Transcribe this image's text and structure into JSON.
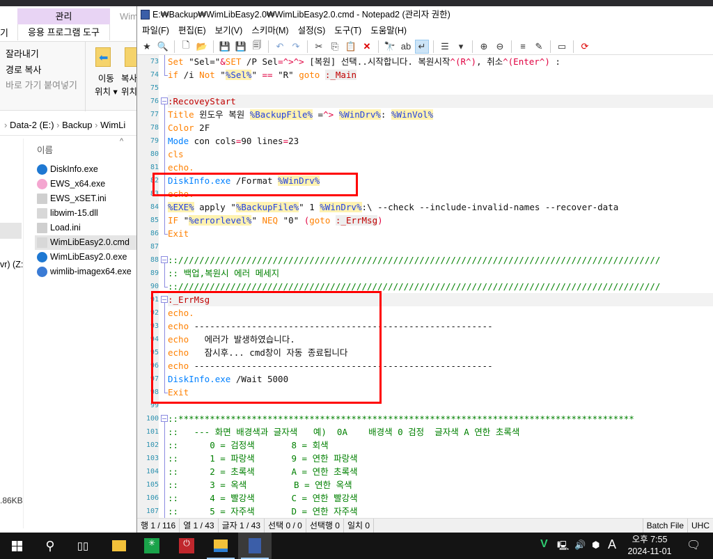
{
  "explorer": {
    "tabs": {
      "manage": "관리",
      "app_tools": "응용 프로그램 도구",
      "window_title_partial": "Wim",
      "left_cut": "기"
    },
    "ribbon": {
      "cut": "잘라내기",
      "copy_path": "경로 복사",
      "paste_shortcut": "바로 가기 붙여넣기",
      "move_to_1": "이동",
      "move_to_2": "위치 ▾",
      "copy_to_1": "복사",
      "copy_to_2": "위치"
    },
    "breadcrumb": [
      "Data-2 (E:)",
      "Backup",
      "WimLi"
    ],
    "column_name": "이름",
    "files": [
      {
        "name": "DiskInfo.exe",
        "icon": "windows-exe-icon",
        "color": "#1e78d2"
      },
      {
        "name": "EWS_x64.exe",
        "icon": "windows-logo-icon",
        "color": "#f4a6d0"
      },
      {
        "name": "EWS_xSET.ini",
        "icon": "settings-file-icon",
        "color": "#cfcfcf"
      },
      {
        "name": "libwim-15.dll",
        "icon": "dll-file-icon",
        "color": "#d8d8d8"
      },
      {
        "name": "Load.ini",
        "icon": "settings-file-icon",
        "color": "#cfcfcf"
      },
      {
        "name": "WimLibEasy2.0.cmd",
        "icon": "cmd-file-icon",
        "color": "#d8d8d8",
        "selected": true
      },
      {
        "name": "WimLibEasy2.0.exe",
        "icon": "windows-exe-icon",
        "color": "#1e78d2"
      },
      {
        "name": "wimlib-imagex64.exe",
        "icon": "exe-window-icon",
        "color": "#3a7bd5"
      }
    ],
    "nav_drive_partial": "vr) (Z:",
    "status_size_partial": ".86KB"
  },
  "notepad": {
    "title": "E:₩Backup₩WimLibEasy2.0₩WimLibEasy2.0.cmd - Notepad2 (관리자 권한)",
    "menu": [
      "파일(F)",
      "편집(E)",
      "보기(V)",
      "스키마(M)",
      "설정(S)",
      "도구(T)",
      "도움말(H)"
    ],
    "toolbar": [
      "favorites-icon",
      "open-favorites-icon",
      "|",
      "new-icon",
      "open-icon",
      "|",
      "save-icon",
      "save-as-icon",
      "save-copy-icon",
      "|",
      "undo-icon",
      "redo-icon",
      "|",
      "cut-icon",
      "copy-icon",
      "paste-icon",
      "delete-icon",
      "|",
      "find-icon",
      "replace-icon",
      "word-wrap-icon",
      "|",
      "scheme-icon",
      "dropdown-icon",
      "|",
      "zoom-in-icon",
      "zoom-out-icon",
      "|",
      "view-list-icon",
      "edit-doc-icon",
      "|",
      "console-icon",
      "|",
      "exit-icon"
    ],
    "lines": [
      {
        "n": "73",
        "fold": "line",
        "seg": [
          [
            "k",
            "Set"
          ],
          [
            "t",
            " \"Sel=\""
          ],
          [
            "o",
            "&"
          ],
          [
            "k",
            "SET"
          ],
          [
            "t",
            " /P Sel"
          ],
          [
            "o",
            "=^>^>"
          ],
          [
            "t",
            " [복원] 선택..시작합니다. 복원시작"
          ],
          [
            "o",
            "^(R^)"
          ],
          [
            "t",
            ", 취소"
          ],
          [
            "o",
            "^(Enter^)"
          ],
          [
            "t",
            " :"
          ]
        ]
      },
      {
        "n": "74",
        "fold": "end",
        "seg": [
          [
            "k",
            "if"
          ],
          [
            "t",
            " /i "
          ],
          [
            "k",
            "Not"
          ],
          [
            "t",
            " \""
          ],
          [
            "v",
            "%Sel%"
          ],
          [
            "t",
            "\" "
          ],
          [
            "o",
            "=="
          ],
          [
            "t",
            " \"R\" "
          ],
          [
            "k",
            "goto"
          ],
          [
            "t",
            " "
          ],
          [
            "lb",
            ":_Main"
          ]
        ]
      },
      {
        "n": "75",
        "fold": "",
        "seg": []
      },
      {
        "n": "76",
        "fold": "box",
        "hl": true,
        "seg": [
          [
            "l",
            ":RecoveyStart"
          ]
        ]
      },
      {
        "n": "77",
        "fold": "line",
        "seg": [
          [
            "k",
            "Title"
          ],
          [
            "t",
            " 윈도우 복원 "
          ],
          [
            "v",
            "%BackupFile%"
          ],
          [
            "t",
            " ="
          ],
          [
            "o",
            "^>"
          ],
          [
            "t",
            " "
          ],
          [
            "v",
            "%WinDrv%"
          ],
          [
            "t",
            ": "
          ],
          [
            "v",
            "%WinVol%"
          ]
        ]
      },
      {
        "n": "78",
        "fold": "line",
        "seg": [
          [
            "k",
            "Color"
          ],
          [
            "t",
            " 2F"
          ]
        ]
      },
      {
        "n": "79",
        "fold": "line",
        "seg": [
          [
            "c",
            "Mode"
          ],
          [
            "t",
            " con cols"
          ],
          [
            "o",
            "="
          ],
          [
            "t",
            "90 lines"
          ],
          [
            "o",
            "="
          ],
          [
            "t",
            "23"
          ]
        ]
      },
      {
        "n": "80",
        "fold": "line",
        "seg": [
          [
            "k",
            "cls"
          ]
        ]
      },
      {
        "n": "81",
        "fold": "line",
        "seg": [
          [
            "k",
            "echo."
          ]
        ]
      },
      {
        "n": "82",
        "fold": "line",
        "seg": [
          [
            "c",
            "DiskInfo.exe"
          ],
          [
            "t",
            " /Format "
          ],
          [
            "v",
            "%WinDrv%"
          ]
        ]
      },
      {
        "n": "83",
        "fold": "line",
        "seg": [
          [
            "k",
            "echo."
          ]
        ]
      },
      {
        "n": "84",
        "fold": "line",
        "seg": [
          [
            "v",
            "%EXE%"
          ],
          [
            "t",
            " apply \""
          ],
          [
            "v",
            "%BackupFile%"
          ],
          [
            "t",
            "\" 1 "
          ],
          [
            "v",
            "%WinDrv%"
          ],
          [
            "t",
            ":\\ --check --include-invalid-names --recover-data"
          ]
        ]
      },
      {
        "n": "85",
        "fold": "line",
        "seg": [
          [
            "k",
            "IF"
          ],
          [
            "t",
            " \""
          ],
          [
            "v",
            "%errorlevel%"
          ],
          [
            "t",
            "\" "
          ],
          [
            "k",
            "NEQ"
          ],
          [
            "t",
            " \"0\" "
          ],
          [
            "o",
            "("
          ],
          [
            "k",
            "goto"
          ],
          [
            "t",
            " "
          ],
          [
            "lb",
            ":_ErrMsg"
          ],
          [
            "o",
            ")"
          ]
        ]
      },
      {
        "n": "86",
        "fold": "end",
        "seg": [
          [
            "k",
            "Exit"
          ]
        ]
      },
      {
        "n": "87",
        "fold": "",
        "seg": []
      },
      {
        "n": "88",
        "fold": "box",
        "seg": [
          [
            "cm",
            "::////////////////////////////////////////////////////////////////////////////////////////////"
          ]
        ]
      },
      {
        "n": "89",
        "fold": "line",
        "seg": [
          [
            "cm",
            ":: 백업,복원시 에러 메세지"
          ]
        ]
      },
      {
        "n": "90",
        "fold": "end",
        "seg": [
          [
            "cm",
            "::////////////////////////////////////////////////////////////////////////////////////////////"
          ]
        ]
      },
      {
        "n": "91",
        "fold": "box",
        "hl": true,
        "seg": [
          [
            "l",
            ":_ErrMsg"
          ]
        ]
      },
      {
        "n": "92",
        "fold": "line",
        "seg": [
          [
            "k",
            "echo."
          ]
        ]
      },
      {
        "n": "93",
        "fold": "line",
        "seg": [
          [
            "k",
            "echo"
          ],
          [
            "t",
            " ---------------------------------------------------------"
          ]
        ]
      },
      {
        "n": "94",
        "fold": "line",
        "seg": [
          [
            "k",
            "echo"
          ],
          [
            "t",
            "   에러가 발생하였습니다."
          ]
        ]
      },
      {
        "n": "95",
        "fold": "line",
        "seg": [
          [
            "k",
            "echo"
          ],
          [
            "t",
            "   잠시후... cmd창이 자동 종료됩니다"
          ]
        ]
      },
      {
        "n": "96",
        "fold": "line",
        "seg": [
          [
            "k",
            "echo"
          ],
          [
            "t",
            " ---------------------------------------------------------"
          ]
        ]
      },
      {
        "n": "97",
        "fold": "line",
        "seg": [
          [
            "c",
            "DiskInfo.exe"
          ],
          [
            "t",
            " /Wait 5000"
          ]
        ]
      },
      {
        "n": "98",
        "fold": "end",
        "seg": [
          [
            "k",
            "Exit"
          ]
        ]
      },
      {
        "n": "99",
        "fold": "",
        "seg": []
      },
      {
        "n": "100",
        "fold": "box",
        "seg": [
          [
            "cm",
            "::***************************************************************************************"
          ]
        ]
      },
      {
        "n": "101",
        "fold": "line",
        "seg": [
          [
            "cm",
            "::   --- 화면 배경색과 글자색   예)  0A    배경색 0 검정  글자색 A 연한 초록색"
          ]
        ]
      },
      {
        "n": "102",
        "fold": "line",
        "seg": [
          [
            "cm",
            "::      0 = 검정색       8 = 회색"
          ]
        ]
      },
      {
        "n": "103",
        "fold": "line",
        "seg": [
          [
            "cm",
            "::      1 = 파랑색       9 = 연한 파랑색"
          ]
        ]
      },
      {
        "n": "104",
        "fold": "line",
        "seg": [
          [
            "cm",
            "::      2 = 초록색       A = 연한 초록색"
          ]
        ]
      },
      {
        "n": "105",
        "fold": "line",
        "seg": [
          [
            "cm",
            "::      3 = 옥색         B = 연한 옥색"
          ]
        ]
      },
      {
        "n": "106",
        "fold": "line",
        "seg": [
          [
            "cm",
            "::      4 = 빨강색       C = 연한 빨강색"
          ]
        ]
      },
      {
        "n": "107",
        "fold": "line",
        "seg": [
          [
            "cm",
            "::      5 = 자주색       D = 연한 자주색"
          ]
        ]
      }
    ],
    "status": [
      "행 1 / 116",
      "열 1 / 43",
      "글자 1 / 43",
      "선택 0 / 0",
      "선택행 0",
      "일치 0"
    ],
    "status_right": [
      "Batch File",
      "UHC"
    ],
    "annotation_color": "#ff0000"
  },
  "taskbar": {
    "apps": [
      "start-icon",
      "search-icon",
      "task-view-icon",
      "file-explorer-pinned-icon",
      "green-app-icon",
      "red-power-app-icon",
      "file-explorer-icon",
      "notepad2-icon"
    ],
    "tray": {
      "ime": "A",
      "time": "오후 7:55",
      "date": "2024-11-01"
    }
  }
}
